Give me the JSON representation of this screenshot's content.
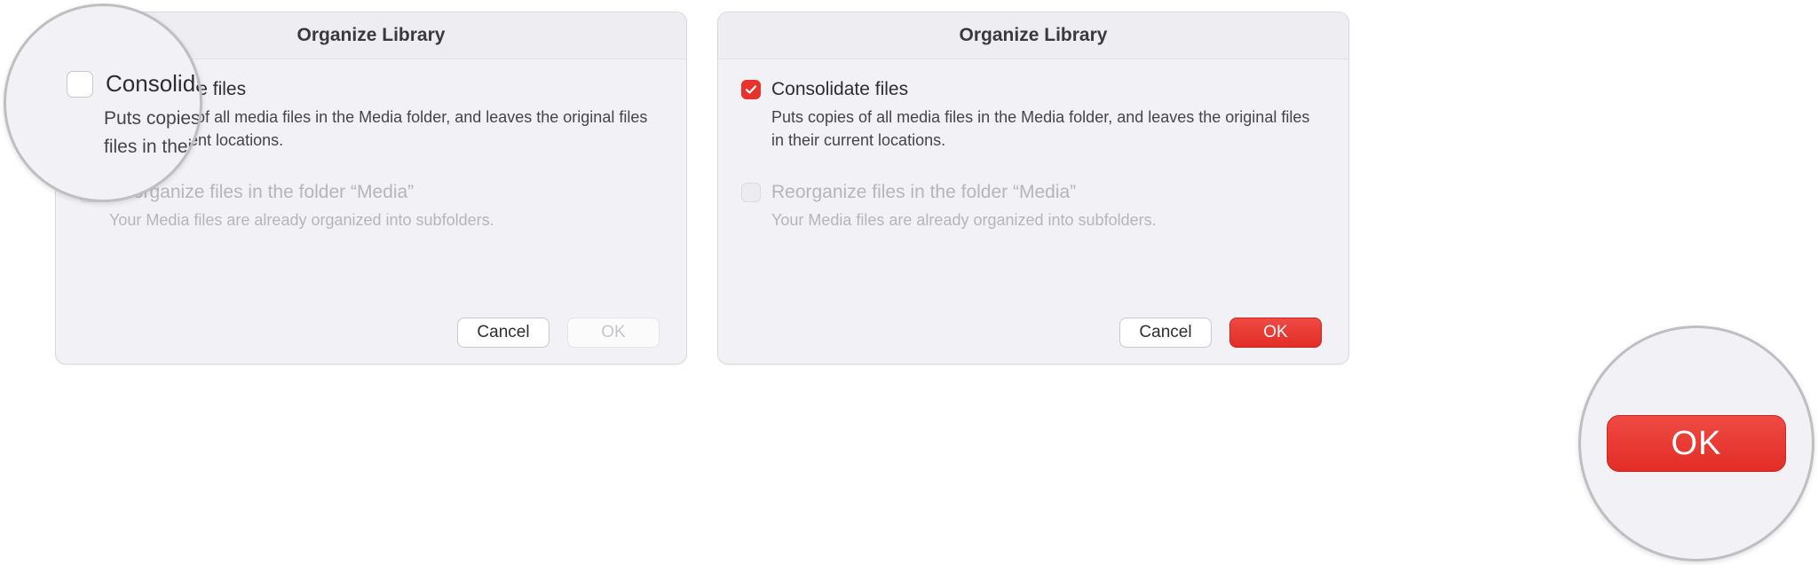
{
  "dialogs": [
    {
      "title": "Organize Library",
      "option1": {
        "label": "Consolidate files",
        "desc": "Puts copies of all media files in the Media folder, and leaves the original files in their current locations.",
        "checked": false
      },
      "option2": {
        "label": "Reorganize files in the folder “Media”",
        "desc": "Your Media files are already organized into subfolders.",
        "enabled": false
      },
      "buttons": {
        "cancel": "Cancel",
        "ok": "OK",
        "ok_enabled": false
      }
    },
    {
      "title": "Organize Library",
      "option1": {
        "label": "Consolidate files",
        "desc": "Puts copies of all media files in the Media folder, and leaves the original files in their current locations.",
        "checked": true
      },
      "option2": {
        "label": "Reorganize files in the folder “Media”",
        "desc": "Your Media files are already organized into subfolders.",
        "enabled": false
      },
      "buttons": {
        "cancel": "Cancel",
        "ok": "OK",
        "ok_enabled": true
      }
    }
  ],
  "loupes": {
    "left": {
      "label": "Consolidate files",
      "desc_line1": "Puts copies of all media files in the Media folder, and leaves the original",
      "desc_line2": "files in their current locations."
    },
    "right": {
      "ok": "OK"
    }
  }
}
